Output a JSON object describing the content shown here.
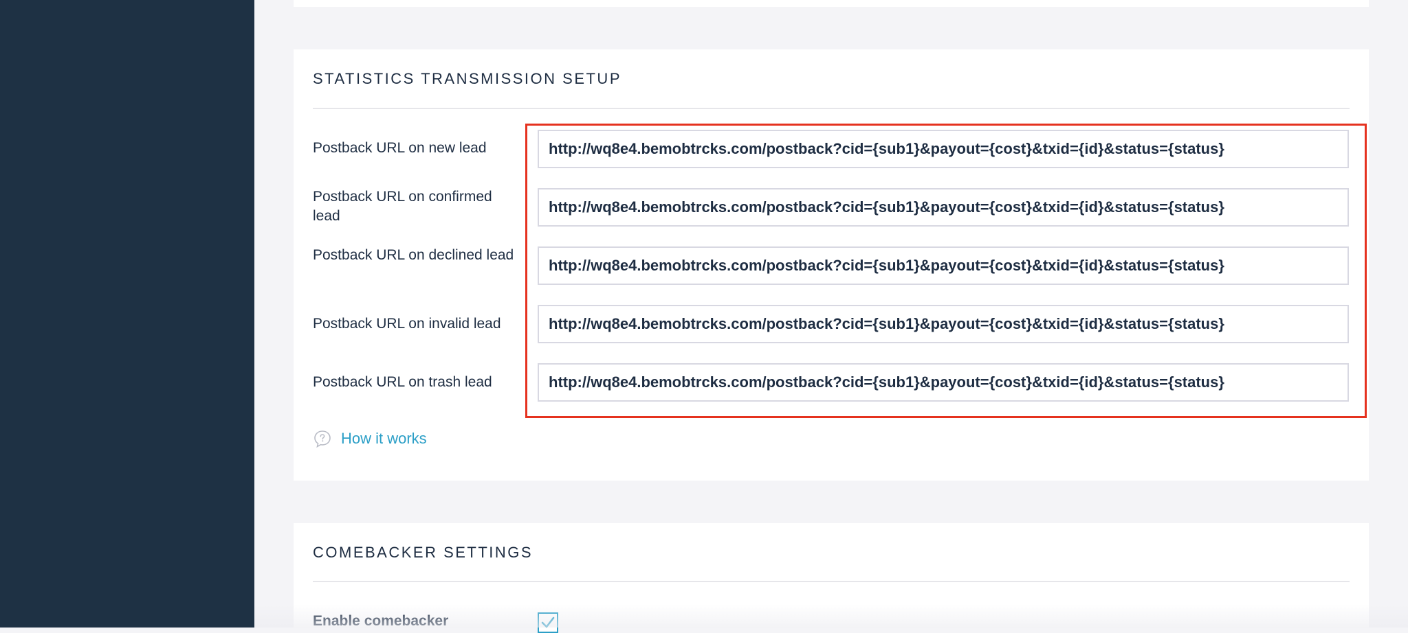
{
  "stats_section": {
    "title": "STATISTICS TRANSMISSION SETUP",
    "rows": [
      {
        "label": "Postback URL on new lead",
        "value": "http://wq8e4.bemobtrcks.com/postback?cid={sub1}&payout={cost}&txid={id}&status={status}"
      },
      {
        "label": "Postback URL on confirmed lead",
        "value": "http://wq8e4.bemobtrcks.com/postback?cid={sub1}&payout={cost}&txid={id}&status={status}"
      },
      {
        "label": "Postback URL on declined lead",
        "value": "http://wq8e4.bemobtrcks.com/postback?cid={sub1}&payout={cost}&txid={id}&status={status}"
      },
      {
        "label": "Postback URL on invalid lead",
        "value": "http://wq8e4.bemobtrcks.com/postback?cid={sub1}&payout={cost}&txid={id}&status={status}"
      },
      {
        "label": "Postback URL on trash lead",
        "value": "http://wq8e4.bemobtrcks.com/postback?cid={sub1}&payout={cost}&txid={id}&status={status}"
      }
    ],
    "how_it_works_label": "How it works"
  },
  "comebacker_section": {
    "title": "COMEBACKER SETTINGS",
    "enable_label": "Enable comebacker",
    "enable_checked": true
  },
  "colors": {
    "sidebar": "#1e3144",
    "highlight": "#e5321f",
    "link": "#2c9fc7"
  },
  "icons": {
    "help": "speech-bubble-question-icon",
    "check": "checkmark-icon"
  }
}
